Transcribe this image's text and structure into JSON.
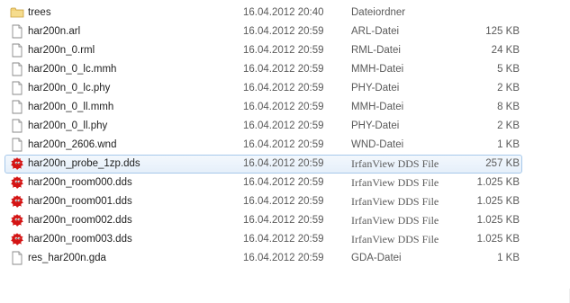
{
  "files": [
    {
      "name": "trees",
      "date": "16.04.2012 20:40",
      "type": "Dateiordner",
      "size": "",
      "icon": "folder-icon"
    },
    {
      "name": "har200n.arl",
      "date": "16.04.2012 20:59",
      "type": "ARL-Datei",
      "size": "125 KB",
      "icon": "file-icon"
    },
    {
      "name": "har200n_0.rml",
      "date": "16.04.2012 20:59",
      "type": "RML-Datei",
      "size": "24 KB",
      "icon": "file-icon"
    },
    {
      "name": "har200n_0_lc.mmh",
      "date": "16.04.2012 20:59",
      "type": "MMH-Datei",
      "size": "5 KB",
      "icon": "file-icon"
    },
    {
      "name": "har200n_0_lc.phy",
      "date": "16.04.2012 20:59",
      "type": "PHY-Datei",
      "size": "2 KB",
      "icon": "file-icon"
    },
    {
      "name": "har200n_0_ll.mmh",
      "date": "16.04.2012 20:59",
      "type": "MMH-Datei",
      "size": "8 KB",
      "icon": "file-icon"
    },
    {
      "name": "har200n_0_ll.phy",
      "date": "16.04.2012 20:59",
      "type": "PHY-Datei",
      "size": "2 KB",
      "icon": "file-icon"
    },
    {
      "name": "har200n_2606.wnd",
      "date": "16.04.2012 20:59",
      "type": "WND-Datei",
      "size": "1 KB",
      "icon": "file-icon"
    },
    {
      "name": "har200n_probe_1zp.dds",
      "date": "16.04.2012 20:59",
      "type": "IrfanView DDS File",
      "size": "257 KB",
      "icon": "irfanview-icon",
      "selected": true
    },
    {
      "name": "har200n_room000.dds",
      "date": "16.04.2012 20:59",
      "type": "IrfanView DDS File",
      "size": "1.025 KB",
      "icon": "irfanview-icon"
    },
    {
      "name": "har200n_room001.dds",
      "date": "16.04.2012 20:59",
      "type": "IrfanView DDS File",
      "size": "1.025 KB",
      "icon": "irfanview-icon"
    },
    {
      "name": "har200n_room002.dds",
      "date": "16.04.2012 20:59",
      "type": "IrfanView DDS File",
      "size": "1.025 KB",
      "icon": "irfanview-icon"
    },
    {
      "name": "har200n_room003.dds",
      "date": "16.04.2012 20:59",
      "type": "IrfanView DDS File",
      "size": "1.025 KB",
      "icon": "irfanview-icon"
    },
    {
      "name": "res_har200n.gda",
      "date": "16.04.2012 20:59",
      "type": "GDA-Datei",
      "size": "1 KB",
      "icon": "file-icon"
    }
  ],
  "colors": {
    "selection_border": "#a6c8ea",
    "selection_fill": "#e5effa",
    "folder": "#e8c25a",
    "irfanview_red": "#d41414"
  }
}
